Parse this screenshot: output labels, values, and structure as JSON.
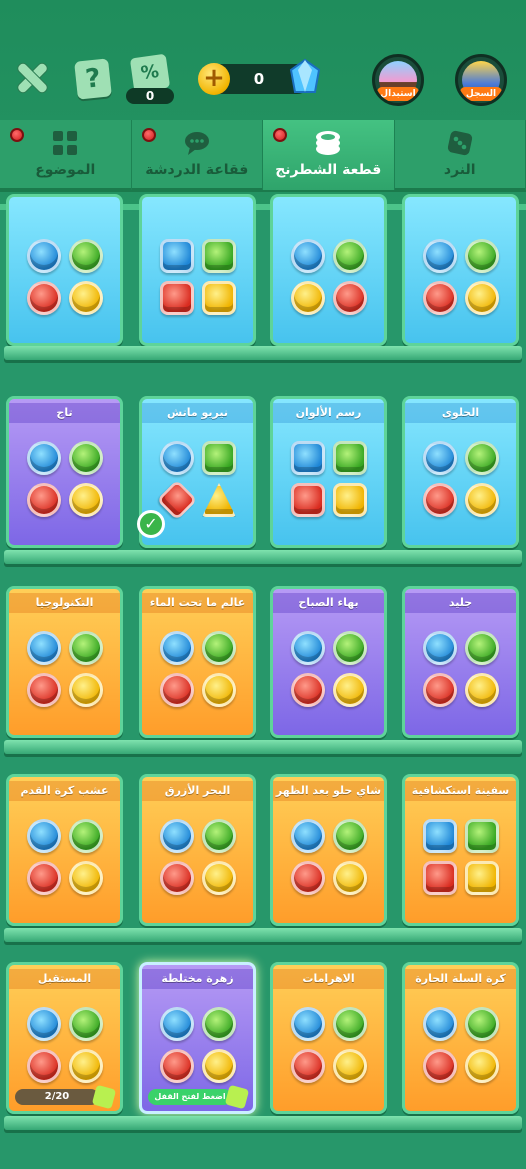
{
  "topbar": {
    "help_label": "?",
    "discount_label": "%",
    "discount_count": "0",
    "coins": "0",
    "exchange_label": "استبدال",
    "record_label": "السجل"
  },
  "tabs": [
    {
      "label": "الموضوع",
      "icon": "grid-icon",
      "dot": true
    },
    {
      "label": "فقاعة الدردشة",
      "icon": "chat-bubble-icon",
      "dot": true
    },
    {
      "label": "قطعة الشطرنج",
      "icon": "game-piece-icon",
      "dot": true,
      "active": true
    },
    {
      "label": "النرد",
      "icon": "dice-icon",
      "dot": false
    }
  ],
  "rows": [
    {
      "cards": [
        {
          "title": "",
          "style": "blue",
          "pieces": "coin"
        },
        {
          "title": "",
          "style": "blue",
          "pieces": "chest"
        },
        {
          "title": "",
          "style": "blue",
          "pieces": "pineapple"
        },
        {
          "title": "",
          "style": "blue",
          "pieces": "crown-coin"
        }
      ]
    },
    {
      "cards": [
        {
          "title": "تاج",
          "style": "purple",
          "pieces": "crown"
        },
        {
          "title": "نيريو ماتش",
          "style": "blue",
          "pieces": "candy-shapes",
          "selected": true
        },
        {
          "title": "رسم الألوان",
          "style": "blue",
          "pieces": "paint-bucket"
        },
        {
          "title": "الحلوى",
          "style": "blue",
          "pieces": "swirl-candy"
        }
      ]
    },
    {
      "cards": [
        {
          "title": "التكنولوجيا",
          "style": "orange",
          "pieces": "tech"
        },
        {
          "title": "عالم ما تحت الماء",
          "style": "orange",
          "pieces": "dolphin"
        },
        {
          "title": "بهاء الصباح",
          "style": "purple",
          "pieces": "flower"
        },
        {
          "title": "جليد",
          "style": "purple",
          "pieces": "snowman"
        }
      ]
    },
    {
      "cards": [
        {
          "title": "عشب كرة القدم",
          "style": "orange",
          "pieces": "football"
        },
        {
          "title": "البحر الأزرق",
          "style": "orange",
          "pieces": "star"
        },
        {
          "title": "شاي حلو بعد الظهر",
          "style": "orange",
          "pieces": "macaron"
        },
        {
          "title": "سفينة استكشافية",
          "style": "orange",
          "pieces": "ship"
        }
      ]
    },
    {
      "cards": [
        {
          "title": "المستقبل",
          "style": "orange",
          "pieces": "future",
          "progress": "2/20"
        },
        {
          "title": "زهرة مختلطة",
          "style": "purple",
          "pieces": "bouquet",
          "unlock": "اضغط لفتح القفل"
        },
        {
          "title": "الاهرامات",
          "style": "orange",
          "pieces": "pyramid"
        },
        {
          "title": "كرة السلة الحارة",
          "style": "orange",
          "pieces": "basketball"
        }
      ]
    }
  ]
}
